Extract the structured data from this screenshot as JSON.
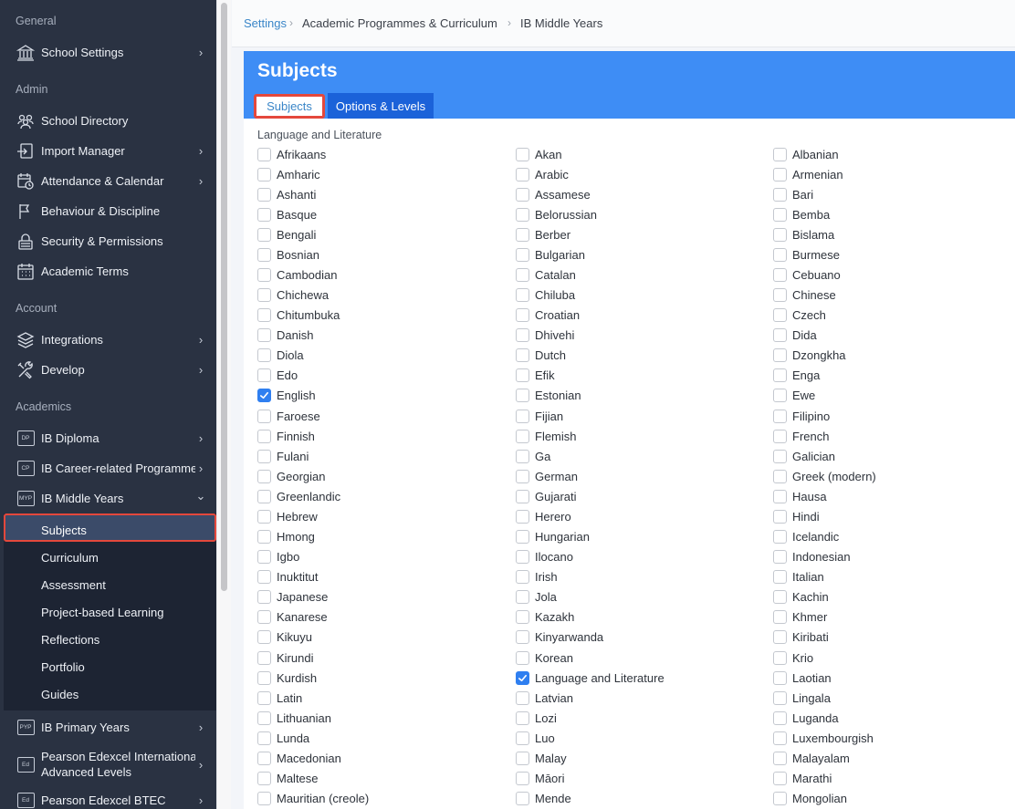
{
  "sidebar": {
    "sections": {
      "general": "General",
      "admin": "Admin",
      "account": "Account",
      "academics": "Academics"
    },
    "items": {
      "school_settings": "School Settings",
      "school_directory": "School Directory",
      "import_manager": "Import Manager",
      "attendance_calendar": "Attendance & Calendar",
      "behaviour_discipline": "Behaviour & Discipline",
      "security_permissions": "Security & Permissions",
      "academic_terms": "Academic Terms",
      "integrations": "Integrations",
      "develop": "Develop",
      "ib_diploma": "IB Diploma",
      "ib_career": "IB Career-related Programme",
      "ib_middle_years": "IB Middle Years",
      "ib_primary_years": "IB Primary Years",
      "pearson_ial_line1": "Pearson Edexcel International",
      "pearson_ial_line2": "Advanced Levels",
      "pearson_btec": "Pearson Edexcel BTEC"
    },
    "badges": {
      "dp": "DP",
      "cp": "CP",
      "myp": "MYP",
      "pyp": "PYP",
      "ed1": "Ed",
      "ed2": "Ed"
    },
    "chevron_right": "›",
    "chevron_down": "⌄",
    "myp_subitems": [
      "Subjects",
      "Curriculum",
      "Assessment",
      "Project-based Learning",
      "Reflections",
      "Portfolio",
      "Guides"
    ]
  },
  "breadcrumb": {
    "settings": "Settings",
    "academic_programmes": "Academic Programmes & Curriculum",
    "ib_middle_years": "IB Middle Years",
    "separator": "›"
  },
  "header": {
    "title": "Subjects",
    "tabs": {
      "subjects": "Subjects",
      "options_levels": "Options & Levels"
    }
  },
  "group": {
    "heading": "Language and Literature"
  },
  "columns": [
    [
      "Afrikaans",
      "Amharic",
      "Ashanti",
      "Basque",
      "Bengali",
      "Bosnian",
      "Cambodian",
      "Chichewa",
      "Chitumbuka",
      "Danish",
      "Diola",
      "Edo",
      "English",
      "Faroese",
      "Finnish",
      "Fulani",
      "Georgian",
      "Greenlandic",
      "Hebrew",
      "Hmong",
      "Igbo",
      "Inuktitut",
      "Japanese",
      "Kanarese",
      "Kikuyu",
      "Kirundi",
      "Kurdish",
      "Latin",
      "Lithuanian",
      "Lunda",
      "Macedonian",
      "Maltese",
      "Mauritian (creole)"
    ],
    [
      "Akan",
      "Arabic",
      "Assamese",
      "Belorussian",
      "Berber",
      "Bulgarian",
      "Catalan",
      "Chiluba",
      "Croatian",
      "Dhivehi",
      "Dutch",
      "Efik",
      "Estonian",
      "Fijian",
      "Flemish",
      "Ga",
      "German",
      "Gujarati",
      "Herero",
      "Hungarian",
      "Ilocano",
      "Irish",
      "Jola",
      "Kazakh",
      "Kinyarwanda",
      "Korean",
      "Language and Literature",
      "Latvian",
      "Lozi",
      "Luo",
      "Malay",
      "Māori",
      "Mende"
    ],
    [
      "Albanian",
      "Armenian",
      "Bari",
      "Bemba",
      "Bislama",
      "Burmese",
      "Cebuano",
      "Chinese",
      "Czech",
      "Dida",
      "Dzongkha",
      "Enga",
      "Ewe",
      "Filipino",
      "French",
      "Galician",
      "Greek (modern)",
      "Hausa",
      "Hindi",
      "Icelandic",
      "Indonesian",
      "Italian",
      "Kachin",
      "Khmer",
      "Kiribati",
      "Krio",
      "Laotian",
      "Lingala",
      "Luganda",
      "Luxembourgish",
      "Malayalam",
      "Marathi",
      "Mongolian"
    ]
  ],
  "checked": [
    "English",
    "Language and Literature"
  ],
  "colors": {
    "accent": "#3e8df5",
    "tab_active_bg": "#1b62d9",
    "highlight": "#e4483c",
    "checkbox_checked": "#2f7ff0"
  }
}
